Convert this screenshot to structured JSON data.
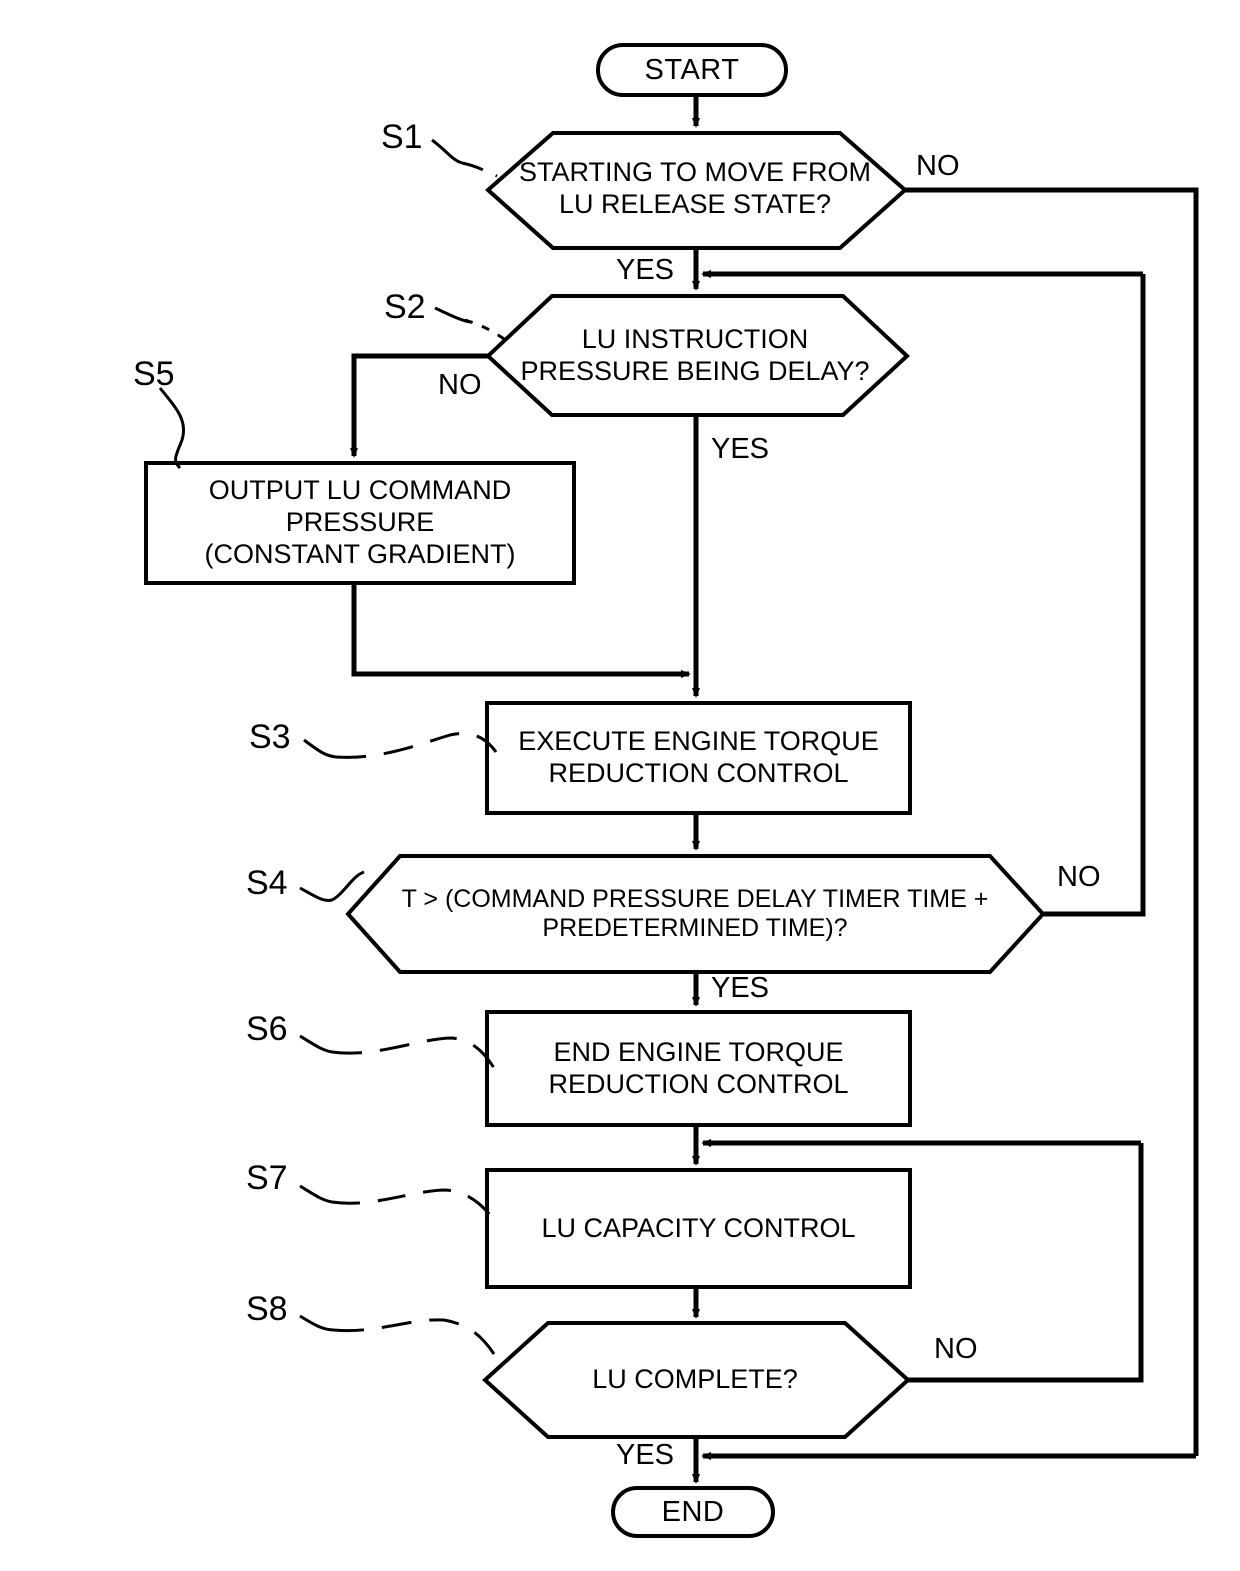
{
  "diagram": {
    "type": "flowchart",
    "title": "",
    "nodes": {
      "start": {
        "id": "START",
        "label": "START",
        "shape": "terminal"
      },
      "s1": {
        "id": "S1",
        "label": "STARTING TO MOVE FROM\nLU RELEASE STATE?",
        "shape": "decision"
      },
      "s2": {
        "id": "S2",
        "label": "LU INSTRUCTION\nPRESSURE BEING DELAY?",
        "shape": "decision"
      },
      "s5": {
        "id": "S5",
        "label": "OUTPUT LU COMMAND\nPRESSURE\n(CONSTANT GRADIENT)",
        "shape": "process"
      },
      "s3": {
        "id": "S3",
        "label": "EXECUTE ENGINE TORQUE\nREDUCTION CONTROL",
        "shape": "process"
      },
      "s4": {
        "id": "S4",
        "label": "T > (COMMAND PRESSURE DELAY TIMER TIME +\nPREDETERMINED TIME)?",
        "shape": "decision"
      },
      "s6": {
        "id": "S6",
        "label": "END ENGINE TORQUE\nREDUCTION CONTROL",
        "shape": "process"
      },
      "s7": {
        "id": "S7",
        "label": "LU CAPACITY CONTROL",
        "shape": "process"
      },
      "s8": {
        "id": "S8",
        "label": "LU COMPLETE?",
        "shape": "decision"
      },
      "end": {
        "id": "END",
        "label": "END",
        "shape": "terminal"
      }
    },
    "step_labels": [
      {
        "key": "s1",
        "text": "S1"
      },
      {
        "key": "s2",
        "text": "S2"
      },
      {
        "key": "s5",
        "text": "S5"
      },
      {
        "key": "s3",
        "text": "S3"
      },
      {
        "key": "s4",
        "text": "S4"
      },
      {
        "key": "s6",
        "text": "S6"
      },
      {
        "key": "s7",
        "text": "S7"
      },
      {
        "key": "s8",
        "text": "S8"
      }
    ],
    "edge_labels": {
      "s1_no": "NO",
      "s1_yes": "YES",
      "s2_no": "NO",
      "s2_yes": "YES",
      "s4_no": "NO",
      "s4_yes": "YES",
      "s8_no": "NO",
      "s8_yes": "YES"
    },
    "colors": {
      "stroke": "#000000",
      "fill": "#ffffff",
      "text": "#000000"
    }
  }
}
